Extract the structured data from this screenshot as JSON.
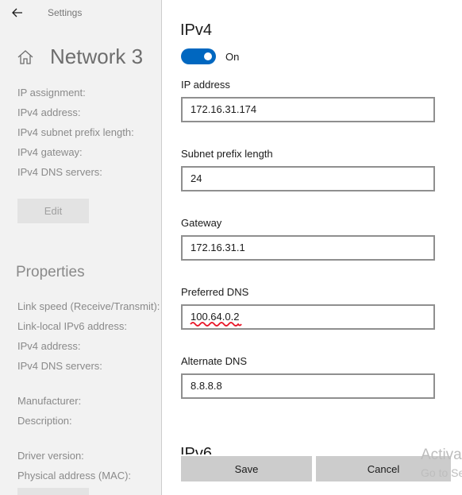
{
  "window": {
    "app_title": "Settings",
    "back_icon": "back-arrow-icon",
    "home_icon": "home-icon"
  },
  "page": {
    "title": "Network 3"
  },
  "ip_settings": {
    "labels": [
      "IP assignment:",
      "IPv4 address:",
      "IPv4 subnet prefix length:",
      "IPv4 gateway:",
      "IPv4 DNS servers:"
    ],
    "edit_button": "Edit"
  },
  "properties": {
    "title": "Properties",
    "labels": [
      "Link speed (Receive/Transmit):",
      "Link-local IPv6 address:",
      "IPv4 address:",
      "IPv4 DNS servers:",
      "Manufacturer:",
      "Description:",
      "Driver version:",
      "Physical address (MAC):"
    ]
  },
  "dialog": {
    "ipv4_heading": "IPv4",
    "toggle_label": "On",
    "toggle_state": "on",
    "fields": [
      {
        "label": "IP address",
        "value": "172.16.31.174"
      },
      {
        "label": "Subnet prefix length",
        "value": "24"
      },
      {
        "label": "Gateway",
        "value": "172.16.31.1"
      },
      {
        "label": "Preferred DNS",
        "value": "100.64.0.2"
      },
      {
        "label": "Alternate DNS",
        "value": "8.8.8.8"
      }
    ],
    "ipv6_heading": "IPv6",
    "save_button": "Save",
    "cancel_button": "Cancel"
  },
  "watermark": {
    "line1": "Activa",
    "line2": "Go to Se"
  },
  "colors": {
    "accent": "#0067c0",
    "annotation": "#e81123"
  }
}
